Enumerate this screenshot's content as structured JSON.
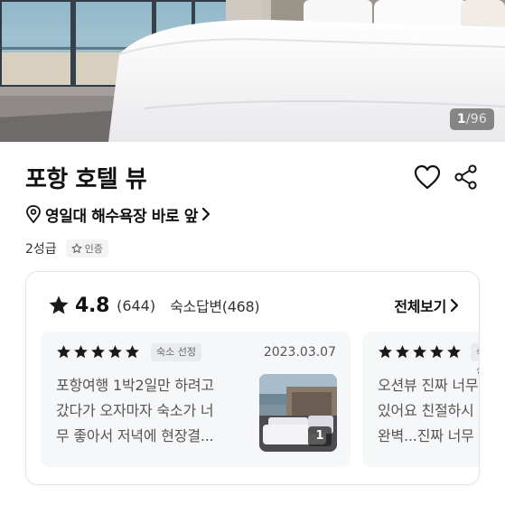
{
  "hero": {
    "photo_index": "1",
    "photo_total": "/96"
  },
  "hotel": {
    "name": "포항 호텔 뷰",
    "location": "영일대 해수욕장 바로 앞",
    "grade": "2성급",
    "certified_label": "인증"
  },
  "icons": {
    "like": "heart-icon",
    "share": "share-icon",
    "location": "location-pin-icon",
    "chevron": "chevron-right-icon",
    "star": "star-icon"
  },
  "reviews": {
    "score": "4.8",
    "count": "(644)",
    "reply_label": "숙소답변(468)",
    "view_all_label": "전체보기",
    "star_color": "#1a1a1a",
    "items": [
      {
        "stars": 5,
        "badge": "숙소 선정",
        "date": "2023.03.07",
        "lines": [
          "포항여행 1박2일만 하려고",
          "갔다가 오자마자 숙소가 너",
          "무 좋아서 저녁에 현장결..."
        ],
        "photo_count": "1"
      },
      {
        "stars": 5,
        "badge": "숙소 선정",
        "lines": [
          "오션뷰 진짜 너무",
          "있어요 친절하시",
          "완벽...진짜 너무"
        ]
      }
    ]
  }
}
